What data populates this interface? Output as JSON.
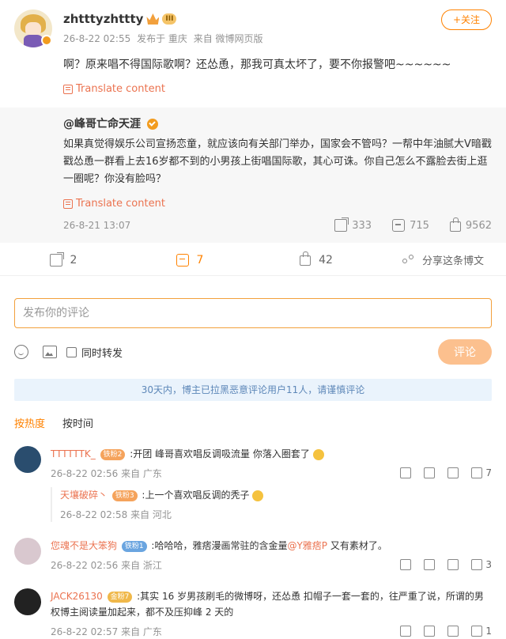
{
  "post": {
    "username": "zhtttyzhttty",
    "level_badge": "III",
    "time": "26-8-22 02:55",
    "location": "发布于 重庆",
    "source": "来自 微博网页版",
    "follow_label": "+关注",
    "text": "啊？原来唱不得国际歌啊？还怂恿，那我可真太坏了，要不你报警吧~~~~~~",
    "translate_label": "Translate content"
  },
  "repost": {
    "author": "@峰哥亡命天涯",
    "text": "如果真觉得娱乐公司宣扬恋童，就应该向有关部门举办，国家会不管吗？一帮中年油腻大V暗戳戳怂恿一群看上去16岁都不到的小男孩上街唱国际歌，其心可诛。你自己怎么不露脸去街上逛一圈呢？你没有脸吗？",
    "translate_label": "Translate content",
    "time": "26-8-21 13:07",
    "shares": "333",
    "comments": "715",
    "likes": "9562"
  },
  "actions": {
    "share_count": "2",
    "comment_count": "7",
    "like_count": "42",
    "share_label": "分享这条博文"
  },
  "composer": {
    "placeholder": "发布你的评论",
    "repost_checkbox_label": "同时转发",
    "submit_label": "评论"
  },
  "notice": "30天内，博主已拉黑恶意评论用户11人，请谨慎评论",
  "sort": {
    "hot": "按热度",
    "time": "按时间"
  },
  "comments": [
    {
      "name": "TTTTTTK_",
      "level": "铁粉2",
      "text": ":开团 峰哥喜欢唱反调吸流量 你落入圈套了",
      "time": "26-8-22 02:56",
      "location": "来自 广东",
      "likes": "7",
      "replies": [
        {
          "name": "天壤破碎丶",
          "level": "铁粉3",
          "text": ":上一个喜欢唱反调的秃子",
          "time": "26-8-22 02:58",
          "location": "来自 河北"
        }
      ]
    },
    {
      "name": "您魂不是大笨狗",
      "level": "铁粉1",
      "text": ":哈哈哈，雅痞漫画常驻的含金量",
      "mention": "@Y雅痞P",
      "text_tail": " 又有素材了。",
      "time": "26-8-22 02:56",
      "location": "来自 浙江",
      "likes": "3"
    },
    {
      "name": "JACK26130",
      "level": "金粉7",
      "text": ":其实 16 岁男孩刷毛的微博呀，还怂恿 扣帽子一套一套的，往严重了说，所谓的男权博主阅读量加起来，都不及压抑峰 2 天的",
      "time": "26-8-22 02:57",
      "location": "来自 广东",
      "likes": "1"
    }
  ],
  "colors": {
    "accent": "#ff8200",
    "name": "#eb7350",
    "notice_bg": "#eaf3fc"
  }
}
